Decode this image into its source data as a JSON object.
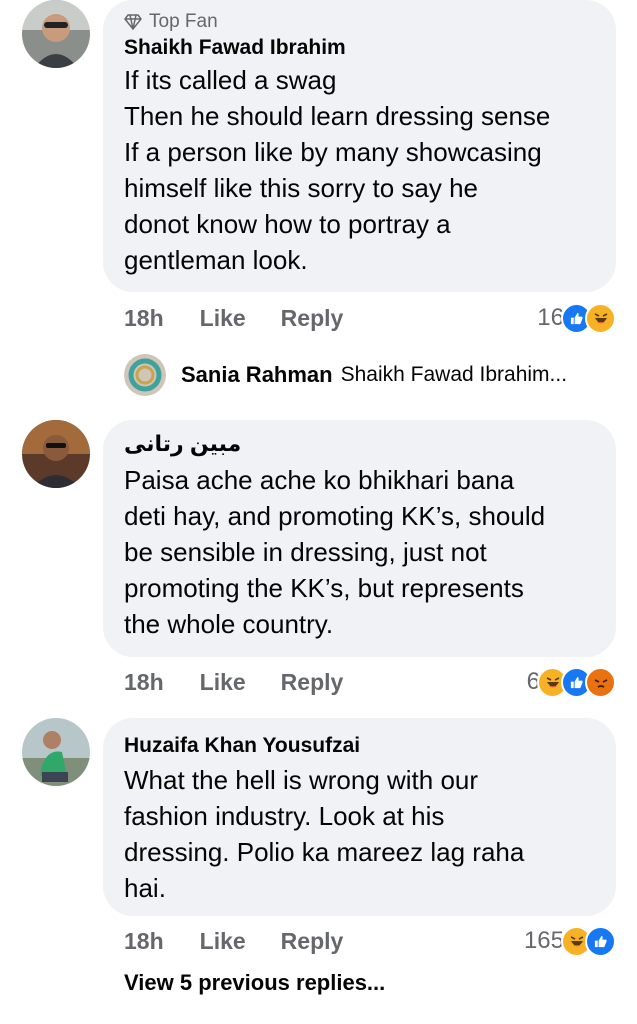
{
  "comments": [
    {
      "badge": "Top Fan",
      "author": "Shaikh Fawad Ibrahim",
      "lines": [
        "If its called a swag",
        "Then he should learn dressing sense",
        "If a person like by many showcasing",
        "himself  like this sorry to say he",
        "donot know how to portray a",
        "gentleman look."
      ],
      "time": "18h",
      "like": "Like",
      "reply": "Reply",
      "reaction_count": "16",
      "reactions": [
        "like-icon",
        "haha-icon"
      ]
    },
    {
      "author": "مبین رتانی",
      "lines": [
        "Paisa ache ache ko bhikhari bana",
        "deti hay, and promoting KK’s, should",
        "be sensible in dressing, just not",
        "promoting the KK’s, but represents",
        "the whole country."
      ],
      "time": "18h",
      "like": "Like",
      "reply": "Reply",
      "reaction_count": "6",
      "reactions": [
        "haha-icon",
        "like-icon",
        "angry-icon"
      ]
    },
    {
      "author": "Huzaifa Khan Yousufzai",
      "lines": [
        "What the hell is wrong with our",
        "fashion industry. Look at his",
        "dressing. Polio ka mareez lag raha",
        "hai."
      ],
      "time": "18h",
      "like": "Like",
      "reply": "Reply",
      "reaction_count": "165",
      "reactions": [
        "haha-icon",
        "like-icon"
      ]
    }
  ],
  "reply_preview": {
    "author": "Sania Rahman",
    "text": "Shaikh Fawad Ibrahim..."
  },
  "view_previous": "View 5 previous replies...",
  "colors": {
    "bubble": "#f0f2f5",
    "secondary_text": "#65676b",
    "like_blue": "#1877f2",
    "haha_yellow": "#f7b125",
    "angry_orange": "#e9710f"
  }
}
